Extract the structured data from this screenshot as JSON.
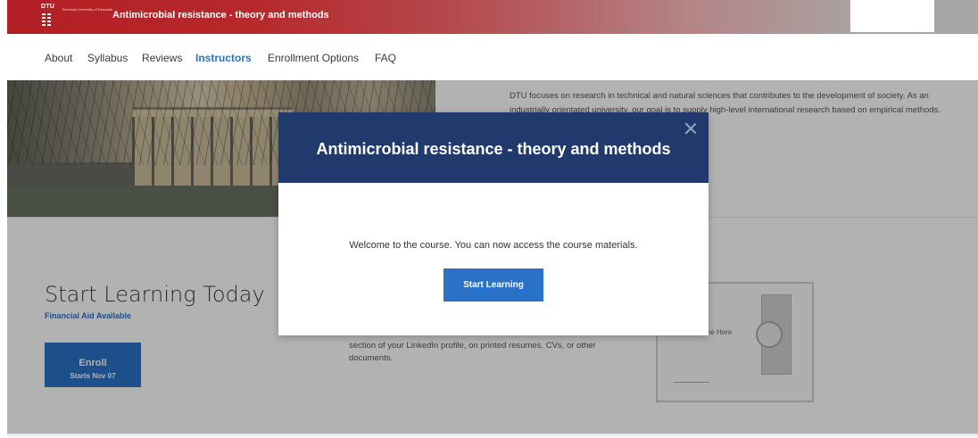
{
  "header": {
    "logo_text": "DTU",
    "logo_subtext": "Technical University of Denmark",
    "course_title": "Antimicrobial resistance - theory and methods"
  },
  "nav": {
    "items": [
      {
        "label": "About"
      },
      {
        "label": "Syllabus"
      },
      {
        "label": "Reviews"
      },
      {
        "label": "Instructors",
        "active": true
      },
      {
        "label": "Enrollment Options"
      },
      {
        "label": "FAQ"
      }
    ]
  },
  "about": {
    "text": "DTU focuses on research in technical and natural sciences that contributes to the development of society. As an industrially orientated university, our goal is to supply high-level international research based on empirical methods."
  },
  "enroll_section": {
    "heading": "Start Learning Today",
    "financial_aid": "Financial Aid Available",
    "enroll_label": "Enroll",
    "starts": "Starts Nov 07",
    "share_text": "section of your LinkedIn profile, on printed resumes, CVs, or other documents.",
    "certificate_name": "Your Name Here"
  },
  "modal": {
    "title": "Antimicrobial resistance - theory and methods",
    "message": "Welcome to the course. You can now access the course materials.",
    "button_label": "Start Learning"
  },
  "colors": {
    "header_red": "#b21f24",
    "modal_navy": "#203a6d",
    "accent_blue": "#2a72c8"
  }
}
